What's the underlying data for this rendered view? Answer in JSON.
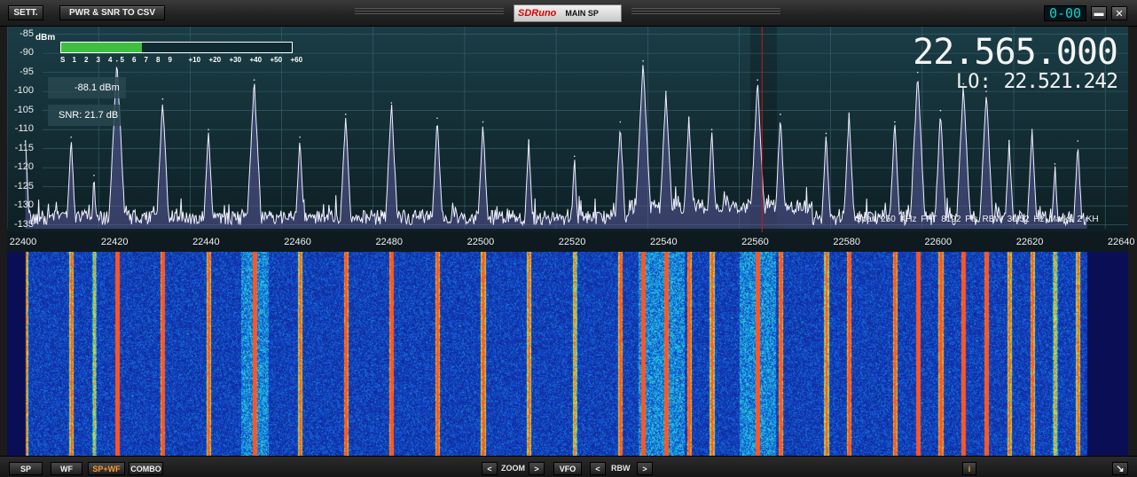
{
  "titlebar": {
    "settings_label": "SETT.",
    "export_label": "PWR & SNR TO CSV",
    "brand_logo": "SDRuno",
    "window_title": "MAIN SP",
    "digital_display": "0-00",
    "minimize_glyph": "▬",
    "close_glyph": "✕"
  },
  "readouts": {
    "dbm_unit": "dBm",
    "power": "-88.1 dBm",
    "snr": "SNR: 21.7 dB",
    "frequency": "22.565.000",
    "lo_label": "LO:",
    "lo_frequency": "22.521.242"
  },
  "smeter": {
    "labels": [
      "S",
      "1",
      "2",
      "3",
      "4",
      "5",
      "6",
      "7",
      "8",
      "9",
      "+10",
      "+20",
      "+30",
      "+40",
      "+50",
      "+60"
    ],
    "fill_fraction": 0.35,
    "fill_color": "#3fbf3f"
  },
  "spectrum_info": {
    "span": "Span 250 KHz",
    "fft": "FFT 8192 Pts",
    "rbw": "RBW 30.52 Hz",
    "marks": "Marks 2 KH"
  },
  "axes": {
    "y_ticks": [
      "-85",
      "-90",
      "-95",
      "-100",
      "-105",
      "-110",
      "-115",
      "-120",
      "-125",
      "-130",
      "-135"
    ],
    "x_ticks": [
      "22400",
      "22420",
      "22440",
      "22460",
      "22480",
      "22500",
      "22520",
      "22540",
      "22560",
      "22580",
      "22600",
      "22620",
      "22640"
    ]
  },
  "bottombar": {
    "sp_label": "SP",
    "wf_label": "WF",
    "spwf_label": "SP+WF",
    "combo_label": "COMBO",
    "zoom_prev": "<",
    "zoom_label": "ZOOM",
    "zoom_next": ">",
    "vfo_label": "VFO",
    "rbw_prev": "<",
    "rbw_label": "RBW",
    "rbw_next": ">",
    "info_label": "i"
  },
  "colors": {
    "spectrum_bg_top": "#1b3d46",
    "spectrum_bg_bottom": "#0d1f24",
    "trace": "#f0f0ff",
    "trace_fill": "#5a5a9a",
    "vfo_marker": "#d01414",
    "active_mode": "#ff9a2a",
    "waterfall_bg": "#0a0f55"
  },
  "chart_data": {
    "type": "line",
    "title": "",
    "xlabel": "",
    "ylabel": "dBm",
    "xlim": [
      22400,
      22645
    ],
    "ylim": [
      -136,
      -83
    ],
    "noise_floor": -133,
    "vfo_frequency": 22565,
    "peaks": [
      {
        "f": 22404,
        "dbm": -113
      },
      {
        "f": 22414,
        "dbm": -112
      },
      {
        "f": 22419,
        "dbm": -122
      },
      {
        "f": 22424,
        "dbm": -92
      },
      {
        "f": 22434,
        "dbm": -102
      },
      {
        "f": 22444,
        "dbm": -110
      },
      {
        "f": 22454,
        "dbm": -97
      },
      {
        "f": 22464,
        "dbm": -112
      },
      {
        "f": 22474,
        "dbm": -106
      },
      {
        "f": 22484,
        "dbm": -103
      },
      {
        "f": 22494,
        "dbm": -107
      },
      {
        "f": 22504,
        "dbm": -108
      },
      {
        "f": 22514,
        "dbm": -113
      },
      {
        "f": 22524,
        "dbm": -117
      },
      {
        "f": 22534,
        "dbm": -108
      },
      {
        "f": 22539,
        "dbm": -92
      },
      {
        "f": 22544,
        "dbm": -100
      },
      {
        "f": 22549,
        "dbm": -107
      },
      {
        "f": 22554,
        "dbm": -110
      },
      {
        "f": 22564,
        "dbm": -97
      },
      {
        "f": 22569,
        "dbm": -106
      },
      {
        "f": 22579,
        "dbm": -111
      },
      {
        "f": 22584,
        "dbm": -106
      },
      {
        "f": 22594,
        "dbm": -108
      },
      {
        "f": 22599,
        "dbm": -95
      },
      {
        "f": 22604,
        "dbm": -105
      },
      {
        "f": 22609,
        "dbm": -98
      },
      {
        "f": 22614,
        "dbm": -100
      },
      {
        "f": 22619,
        "dbm": -113
      },
      {
        "f": 22624,
        "dbm": -110
      },
      {
        "f": 22629,
        "dbm": -119
      },
      {
        "f": 22634,
        "dbm": -113
      }
    ]
  }
}
